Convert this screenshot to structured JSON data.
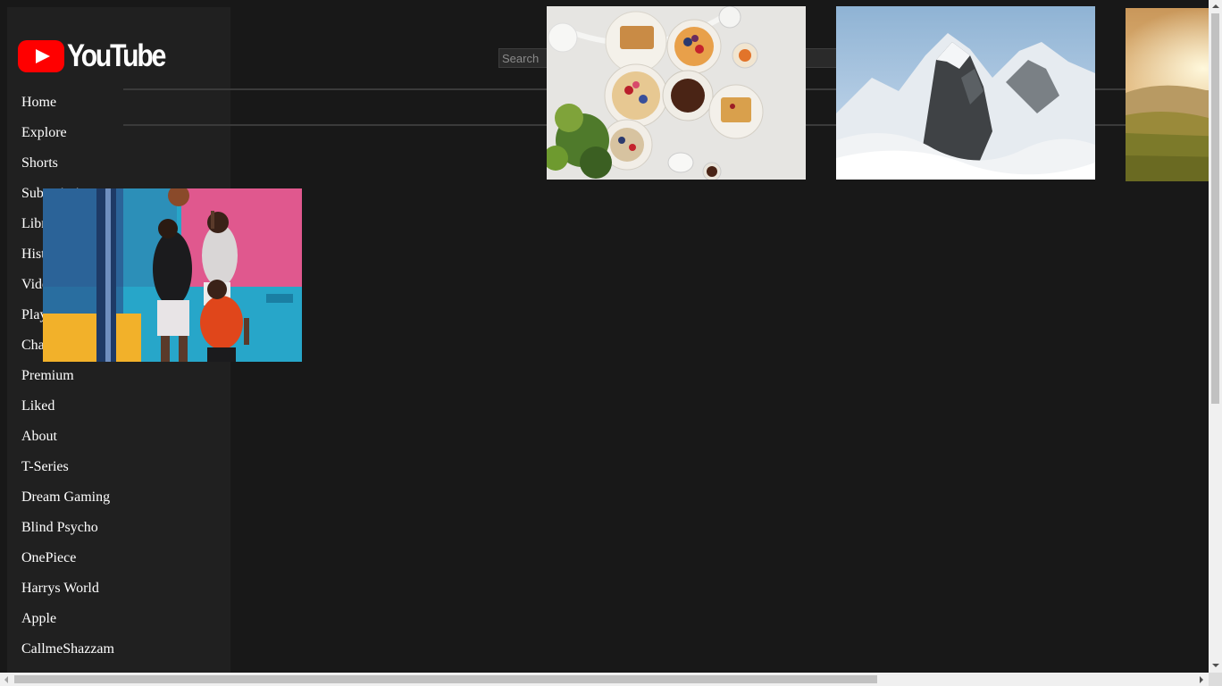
{
  "app": {
    "logo_text": "YouTube"
  },
  "search": {
    "placeholder": "Search"
  },
  "sidebar": {
    "items": [
      {
        "label": "Home"
      },
      {
        "label": "Explore"
      },
      {
        "label": "Shorts"
      },
      {
        "label": "Subscriptions"
      },
      {
        "label": "Library"
      },
      {
        "label": "History"
      },
      {
        "label": "Videos"
      },
      {
        "label": "Playlists"
      },
      {
        "label": "Channels"
      },
      {
        "label": "Premium"
      },
      {
        "label": "Liked"
      },
      {
        "label": "About"
      },
      {
        "label": "T-Series"
      },
      {
        "label": "Dream Gaming"
      },
      {
        "label": "Blind Psycho"
      },
      {
        "label": "OnePiece"
      },
      {
        "label": "Harrys World"
      },
      {
        "label": "Apple"
      },
      {
        "label": "CallmeShazzam"
      }
    ]
  },
  "thumbnails": [
    {
      "icon": "breakfast-food-photo"
    },
    {
      "icon": "snowy-mountain-photo"
    },
    {
      "icon": "sunset-meadow-photo"
    },
    {
      "icon": "basketball-players-photo"
    }
  ],
  "colors": {
    "background": "#181818",
    "sidebar": "#202020",
    "brand_red": "#ff0000"
  }
}
